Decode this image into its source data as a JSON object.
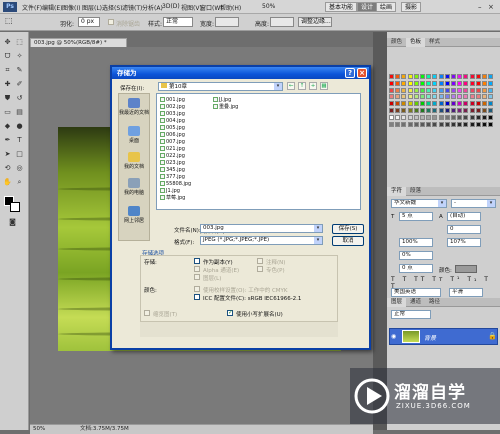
{
  "app": {
    "logo": "Ps",
    "menus": [
      "文件(F)",
      "编辑(E)",
      "图像(I)",
      "图层(L)",
      "选择(S)",
      "滤镜(T)",
      "分析(A)",
      "3D(D)",
      "视图(V)",
      "窗口(W)",
      "帮助(H)"
    ],
    "zoom": "50%",
    "workspaces": [
      "基本功能",
      "设计",
      "绘画",
      "摄影"
    ]
  },
  "options_bar": {
    "feather_label": "羽化:",
    "feather_value": "0 px",
    "antialias_label": "消除锯齿",
    "style_label": "样式:",
    "style_value": "正常",
    "width_label": "宽度:",
    "height_label": "高度:",
    "refine_edge_label": "调整边缘..."
  },
  "document": {
    "tab_title": "003.jpg @ 50%(RGB/8#) *",
    "status_zoom": "50%",
    "status_doc": "文档:3.75M/3.75M"
  },
  "dialog": {
    "title": "存储为",
    "help_btn": "?",
    "close_btn": "×",
    "save_in_label": "保存在(I):",
    "save_in_value": "第10章",
    "places": [
      "我最近的文档",
      "桌面",
      "我的文档",
      "我的电脑",
      "网上邻居"
    ],
    "files_col1": [
      "001.jpg",
      "002.jpg",
      "003.jpg",
      "004.jpg",
      "005.jpg",
      "006.jpg",
      "007.jpg",
      "021.jpg",
      "022.jpg",
      "023.jpg",
      "345.jpg",
      "377.jpg",
      "55808.jpg",
      "J1.jpg",
      "草莓.jpg"
    ],
    "files_col2": [
      "JJ.jpg",
      "重叠.jpg"
    ],
    "filename_label": "文件名(N):",
    "filename_value": "003.jpg",
    "format_label": "格式(F):",
    "format_value": "JPEG (*.JPG;*.JPEG;*.JPE)",
    "save_button": "保存(S)",
    "cancel_button": "取消",
    "save_options_title": "存储选项",
    "storage_label": "存储:",
    "as_copy": "作为副本(Y)",
    "notes": "注释(N)",
    "alpha": "Alpha 通道(E)",
    "spot": "专色(P)",
    "layers": "图层(L)",
    "color_label": "颜色:",
    "proof_setup": "使用校样设置(O):  工作中的 CMYK",
    "icc_profile": "ICC 配置文件(C):  sRGB IEC61966-2.1",
    "thumbnail": "缩览图(T)",
    "lowercase_ext": "使用小写扩展名(U)"
  },
  "right_panels": {
    "tabs_top": [
      "颜色",
      "色板",
      "样式"
    ],
    "char_tabs": [
      "字符",
      "段落"
    ],
    "font_family": "华文新魏",
    "font_style": "-",
    "font_size": "5 点",
    "leading": "(自动)",
    "tracking_value": "0",
    "scale_v": "100%",
    "scale_h": "107%",
    "baseline": "0%",
    "baseline_shift": "0 点",
    "color_label": "颜色:",
    "language": "美国英语",
    "aa": "平滑",
    "layers_tabs": [
      "图层",
      "通道",
      "路径"
    ],
    "blend_mode": "正常",
    "layer_name": "背景"
  },
  "colors": {
    "title_blue": "#0c54d9",
    "dialog_bg": "#ece9d8",
    "layer_selected": "#3f6bd1",
    "watermark_bg": "#2b2f3a"
  },
  "watermark": {
    "brand": "溜溜自学",
    "url": "ZIXUE.3D66.COM"
  }
}
